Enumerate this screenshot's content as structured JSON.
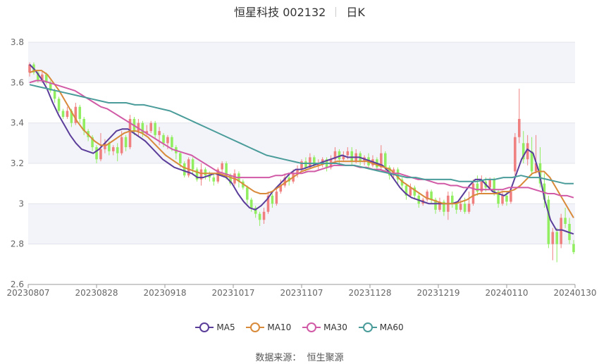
{
  "header": {
    "stock": "恒星科技 002132",
    "period": "日K"
  },
  "legend": [
    {
      "label": "MA5",
      "color": "#5b3d9a"
    },
    {
      "label": "MA10",
      "color": "#d88a3a"
    },
    {
      "label": "MA30",
      "color": "#d15aa6"
    },
    {
      "label": "MA60",
      "color": "#4a9c9a"
    }
  ],
  "source": {
    "label": "数据来源：",
    "value": "恒生聚源"
  },
  "chart_data": {
    "type": "candlestick",
    "ylim": [
      2.6,
      3.8
    ],
    "yticks": [
      2.6,
      2.8,
      3,
      3.2,
      3.4,
      3.6,
      3.8
    ],
    "xticks": [
      "20230807",
      "20230828",
      "20230918",
      "20231017",
      "20231107",
      "20231128",
      "20231219",
      "20240110",
      "20240130"
    ],
    "up_color": "#f08080",
    "down_color": "#90ee60",
    "grid": true,
    "candles": [
      [
        3.65,
        3.69,
        3.7,
        3.63
      ],
      [
        3.69,
        3.65,
        3.7,
        3.64
      ],
      [
        3.65,
        3.61,
        3.66,
        3.6
      ],
      [
        3.61,
        3.64,
        3.66,
        3.6
      ],
      [
        3.64,
        3.6,
        3.65,
        3.59
      ],
      [
        3.6,
        3.56,
        3.61,
        3.55
      ],
      [
        3.56,
        3.52,
        3.57,
        3.5
      ],
      [
        3.52,
        3.46,
        3.53,
        3.45
      ],
      [
        3.46,
        3.43,
        3.47,
        3.42
      ],
      [
        3.43,
        3.46,
        3.48,
        3.42
      ],
      [
        3.46,
        3.4,
        3.47,
        3.38
      ],
      [
        3.4,
        3.48,
        3.5,
        3.39
      ],
      [
        3.48,
        3.42,
        3.49,
        3.4
      ],
      [
        3.42,
        3.36,
        3.43,
        3.34
      ],
      [
        3.36,
        3.33,
        3.37,
        3.31
      ],
      [
        3.33,
        3.28,
        3.34,
        3.26
      ],
      [
        3.28,
        3.22,
        3.29,
        3.2
      ],
      [
        3.22,
        3.27,
        3.35,
        3.21
      ],
      [
        3.27,
        3.3,
        3.32,
        3.25
      ],
      [
        3.3,
        3.26,
        3.31,
        3.24
      ],
      [
        3.26,
        3.28,
        3.29,
        3.24
      ],
      [
        3.28,
        3.25,
        3.3,
        3.21
      ],
      [
        3.25,
        3.33,
        3.36,
        3.24
      ],
      [
        3.33,
        3.28,
        3.34,
        3.26
      ],
      [
        3.28,
        3.42,
        3.44,
        3.27
      ],
      [
        3.42,
        3.36,
        3.43,
        3.34
      ],
      [
        3.36,
        3.4,
        3.42,
        3.33
      ],
      [
        3.4,
        3.35,
        3.41,
        3.33
      ],
      [
        3.35,
        3.36,
        3.39,
        3.34
      ],
      [
        3.36,
        3.4,
        3.41,
        3.35
      ],
      [
        3.4,
        3.34,
        3.41,
        3.32
      ],
      [
        3.34,
        3.36,
        3.38,
        3.29
      ],
      [
        3.34,
        3.3,
        3.35,
        3.28
      ],
      [
        3.3,
        3.33,
        3.34,
        3.27
      ],
      [
        3.33,
        3.28,
        3.34,
        3.26
      ],
      [
        3.28,
        3.25,
        3.29,
        3.22
      ],
      [
        3.25,
        3.2,
        3.26,
        3.18
      ],
      [
        3.2,
        3.14,
        3.21,
        3.13
      ],
      [
        3.14,
        3.22,
        3.23,
        3.13
      ],
      [
        3.22,
        3.17,
        3.23,
        3.15
      ],
      [
        3.17,
        3.12,
        3.18,
        3.11
      ],
      [
        3.12,
        3.17,
        3.2,
        3.09
      ],
      [
        3.17,
        3.14,
        3.18,
        3.12
      ],
      [
        3.14,
        3.13,
        3.16,
        3.11
      ],
      [
        3.13,
        3.11,
        3.15,
        3.09
      ],
      [
        3.11,
        3.17,
        3.18,
        3.1
      ],
      [
        3.17,
        3.2,
        3.21,
        3.15
      ],
      [
        3.2,
        3.14,
        3.21,
        3.12
      ],
      [
        3.14,
        3.1,
        3.15,
        3.09
      ],
      [
        3.1,
        3.15,
        3.17,
        3.09
      ],
      [
        3.15,
        3.11,
        3.16,
        3.08
      ],
      [
        3.11,
        3.08,
        3.12,
        3.07
      ],
      [
        3.08,
        3.02,
        3.09,
        3.0
      ],
      [
        3.02,
        2.98,
        3.03,
        2.96
      ],
      [
        2.98,
        2.95,
        2.99,
        2.93
      ],
      [
        2.95,
        2.92,
        2.96,
        2.89
      ],
      [
        2.92,
        2.96,
        2.98,
        2.9
      ],
      [
        2.96,
        3.04,
        3.06,
        2.95
      ],
      [
        3.04,
        3.0,
        3.05,
        2.98
      ],
      [
        3.0,
        3.06,
        3.08,
        2.99
      ],
      [
        3.06,
        3.09,
        3.12,
        3.05
      ],
      [
        3.09,
        3.13,
        3.15,
        3.08
      ],
      [
        3.13,
        3.11,
        3.15,
        3.09
      ],
      [
        3.11,
        3.15,
        3.17,
        3.1
      ],
      [
        3.15,
        3.17,
        3.19,
        3.13
      ],
      [
        3.17,
        3.21,
        3.22,
        3.16
      ],
      [
        3.21,
        3.18,
        3.23,
        3.16
      ],
      [
        3.18,
        3.23,
        3.25,
        3.17
      ],
      [
        3.23,
        3.19,
        3.24,
        3.18
      ],
      [
        3.19,
        3.2,
        3.22,
        3.17
      ],
      [
        3.2,
        3.22,
        3.23,
        3.18
      ],
      [
        3.22,
        3.18,
        3.23,
        3.16
      ],
      [
        3.18,
        3.22,
        3.24,
        3.17
      ],
      [
        3.22,
        3.26,
        3.28,
        3.2
      ],
      [
        3.26,
        3.22,
        3.27,
        3.2
      ],
      [
        3.22,
        3.24,
        3.26,
        3.21
      ],
      [
        3.24,
        3.26,
        3.28,
        3.22
      ],
      [
        3.26,
        3.21,
        3.28,
        3.19
      ],
      [
        3.21,
        3.25,
        3.27,
        3.2
      ],
      [
        3.25,
        3.21,
        3.26,
        3.19
      ],
      [
        3.21,
        3.23,
        3.24,
        3.19
      ],
      [
        3.23,
        3.19,
        3.25,
        3.17
      ],
      [
        3.19,
        3.22,
        3.24,
        3.18
      ],
      [
        3.22,
        3.18,
        3.23,
        3.16
      ],
      [
        3.18,
        3.25,
        3.29,
        3.17
      ],
      [
        3.25,
        3.18,
        3.26,
        3.16
      ],
      [
        3.18,
        3.14,
        3.19,
        3.12
      ],
      [
        3.14,
        3.17,
        3.18,
        3.12
      ],
      [
        3.17,
        3.12,
        3.18,
        3.1
      ],
      [
        3.12,
        3.09,
        3.13,
        3.07
      ],
      [
        3.09,
        3.04,
        3.1,
        3.02
      ],
      [
        3.04,
        3.08,
        3.1,
        3.03
      ],
      [
        3.08,
        3.04,
        3.09,
        3.02
      ],
      [
        3.04,
        3.0,
        3.05,
        2.98
      ],
      [
        3.0,
        3.02,
        3.03,
        2.99
      ],
      [
        3.02,
        3.06,
        3.07,
        3.01
      ],
      [
        3.06,
        3.02,
        3.07,
        3.0
      ],
      [
        3.02,
        2.97,
        3.03,
        2.95
      ],
      [
        2.97,
        3.01,
        3.03,
        2.96
      ],
      [
        3.01,
        2.96,
        3.02,
        2.94
      ],
      [
        2.96,
        3.04,
        3.06,
        2.92
      ],
      [
        3.04,
        3.0,
        3.06,
        2.98
      ],
      [
        3.0,
        2.97,
        3.01,
        2.95
      ],
      [
        2.97,
        3.0,
        3.02,
        2.96
      ],
      [
        3.0,
        2.96,
        3.03,
        2.95
      ],
      [
        2.96,
        3.0,
        3.06,
        2.95
      ],
      [
        3.0,
        3.1,
        3.12,
        2.99
      ],
      [
        3.1,
        3.06,
        3.14,
        3.04
      ],
      [
        3.06,
        3.11,
        3.14,
        3.05
      ],
      [
        3.11,
        3.08,
        3.13,
        3.06
      ],
      [
        3.08,
        3.12,
        3.13,
        3.07
      ],
      [
        3.12,
        3.06,
        3.13,
        3.04
      ],
      [
        3.06,
        3.0,
        3.07,
        2.98
      ],
      [
        3.0,
        3.04,
        3.06,
        2.99
      ],
      [
        3.04,
        3.01,
        3.06,
        2.99
      ],
      [
        3.01,
        3.06,
        3.08,
        3.0
      ],
      [
        3.16,
        3.33,
        3.35,
        3.14
      ],
      [
        3.33,
        3.42,
        3.57,
        3.3
      ],
      [
        3.3,
        3.22,
        3.36,
        3.2
      ],
      [
        3.22,
        3.3,
        3.34,
        3.19
      ],
      [
        3.26,
        3.16,
        3.33,
        3.14
      ],
      [
        3.16,
        3.2,
        3.34,
        3.15
      ],
      [
        3.2,
        3.1,
        3.28,
        3.08
      ],
      [
        3.1,
        3.02,
        3.15,
        2.98
      ],
      [
        3.02,
        2.8,
        3.04,
        2.78
      ],
      [
        2.8,
        2.86,
        2.88,
        2.72
      ],
      [
        2.86,
        2.8,
        2.88,
        2.71
      ],
      [
        2.8,
        2.93,
        2.95,
        2.78
      ],
      [
        2.93,
        2.9,
        2.98,
        2.88
      ],
      [
        2.9,
        2.82,
        2.93,
        2.8
      ],
      [
        2.8,
        2.76,
        2.82,
        2.75
      ]
    ],
    "series": [
      {
        "name": "MA5",
        "color": "#5b3d9a",
        "values": [
          3.69,
          3.66,
          3.62,
          3.57,
          3.5,
          3.44,
          3.39,
          3.34,
          3.3,
          3.27,
          3.26,
          3.25,
          3.27,
          3.3,
          3.33,
          3.36,
          3.37,
          3.37,
          3.35,
          3.33,
          3.31,
          3.28,
          3.25,
          3.22,
          3.2,
          3.18,
          3.17,
          3.16,
          3.15,
          3.13,
          3.13,
          3.14,
          3.15,
          3.14,
          3.13,
          3.1,
          3.05,
          3.01,
          2.98,
          2.97,
          2.99,
          3.02,
          3.06,
          3.09,
          3.12,
          3.15,
          3.17,
          3.17,
          3.18,
          3.19,
          3.2,
          3.21,
          3.22,
          3.23,
          3.24,
          3.23,
          3.23,
          3.23,
          3.22,
          3.21,
          3.2,
          3.19,
          3.16,
          3.12,
          3.08,
          3.05,
          3.03,
          3.02,
          3.01,
          3.0,
          3.0,
          3.0,
          3.0,
          3.0,
          3.01,
          3.05,
          3.09,
          3.12,
          3.12,
          3.09,
          3.06,
          3.05,
          3.04,
          3.06,
          3.14,
          3.22,
          3.27,
          3.25,
          3.16,
          3.02,
          2.92,
          2.87,
          2.87,
          2.86,
          2.85
        ]
      },
      {
        "name": "MA10",
        "color": "#d88a3a",
        "values": [
          3.65,
          3.66,
          3.66,
          3.64,
          3.6,
          3.56,
          3.51,
          3.46,
          3.41,
          3.37,
          3.34,
          3.31,
          3.29,
          3.29,
          3.31,
          3.33,
          3.35,
          3.36,
          3.36,
          3.35,
          3.33,
          3.3,
          3.27,
          3.24,
          3.22,
          3.2,
          3.18,
          3.17,
          3.16,
          3.15,
          3.15,
          3.15,
          3.15,
          3.14,
          3.13,
          3.12,
          3.1,
          3.08,
          3.06,
          3.05,
          3.05,
          3.06,
          3.08,
          3.1,
          3.12,
          3.14,
          3.16,
          3.17,
          3.18,
          3.19,
          3.2,
          3.2,
          3.21,
          3.21,
          3.21,
          3.21,
          3.21,
          3.21,
          3.2,
          3.19,
          3.18,
          3.17,
          3.14,
          3.11,
          3.09,
          3.07,
          3.05,
          3.03,
          3.02,
          3.01,
          3.0,
          3.0,
          3.0,
          3.01,
          3.02,
          3.04,
          3.05,
          3.05,
          3.05,
          3.05,
          3.06,
          3.06,
          3.07,
          3.09,
          3.12,
          3.15,
          3.16,
          3.16,
          3.13,
          3.08,
          3.03,
          2.98,
          2.93
        ]
      },
      {
        "name": "MA30",
        "color": "#d15aa6",
        "values": [
          3.6,
          3.61,
          3.61,
          3.6,
          3.59,
          3.58,
          3.57,
          3.56,
          3.54,
          3.52,
          3.5,
          3.48,
          3.47,
          3.45,
          3.43,
          3.41,
          3.39,
          3.37,
          3.35,
          3.33,
          3.31,
          3.29,
          3.27,
          3.26,
          3.25,
          3.24,
          3.22,
          3.2,
          3.18,
          3.16,
          3.15,
          3.14,
          3.13,
          3.13,
          3.13,
          3.13,
          3.13,
          3.13,
          3.14,
          3.14,
          3.15,
          3.15,
          3.15,
          3.16,
          3.16,
          3.17,
          3.18,
          3.19,
          3.19,
          3.19,
          3.19,
          3.18,
          3.18,
          3.17,
          3.17,
          3.16,
          3.15,
          3.15,
          3.14,
          3.13,
          3.12,
          3.12,
          3.11,
          3.1,
          3.1,
          3.09,
          3.09,
          3.08,
          3.08,
          3.07,
          3.07,
          3.07,
          3.07,
          3.07,
          3.08,
          3.08,
          3.08,
          3.08,
          3.07,
          3.06,
          3.05,
          3.05,
          3.04,
          3.04,
          3.03
        ]
      },
      {
        "name": "MA60",
        "color": "#4a9c9a",
        "values": [
          3.59,
          3.58,
          3.57,
          3.56,
          3.55,
          3.54,
          3.53,
          3.52,
          3.51,
          3.5,
          3.5,
          3.5,
          3.49,
          3.49,
          3.48,
          3.47,
          3.46,
          3.44,
          3.42,
          3.4,
          3.38,
          3.36,
          3.34,
          3.32,
          3.3,
          3.28,
          3.26,
          3.24,
          3.23,
          3.22,
          3.21,
          3.2,
          3.2,
          3.2,
          3.2,
          3.2,
          3.19,
          3.19,
          3.18,
          3.17,
          3.16,
          3.15,
          3.14,
          3.13,
          3.13,
          3.12,
          3.12,
          3.12,
          3.12,
          3.11,
          3.11,
          3.11,
          3.12,
          3.12,
          3.13,
          3.13,
          3.14,
          3.13,
          3.13,
          3.12,
          3.11,
          3.1,
          3.1
        ]
      }
    ]
  }
}
